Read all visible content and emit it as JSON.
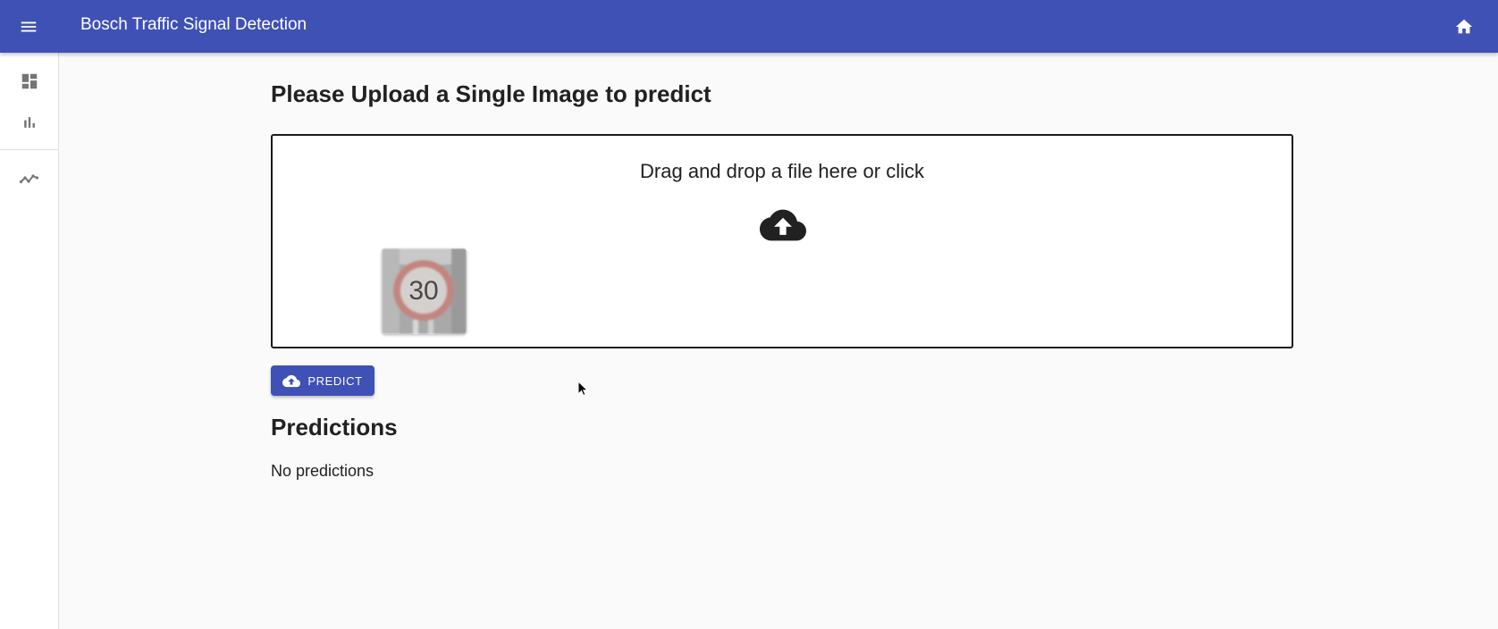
{
  "appbar": {
    "title": "Bosch Traffic Signal Detection",
    "menu_icon": "menu-icon",
    "home_icon": "home-icon",
    "color": "#3f51b5"
  },
  "drawer": {
    "items": [
      {
        "icon": "dashboard-icon"
      },
      {
        "icon": "bar-chart-icon"
      },
      {
        "icon": "timeline-icon"
      }
    ]
  },
  "upload": {
    "heading": "Please Upload a Single Image to predict",
    "dropzone_text": "Drag and drop a file here or click",
    "dropzone_icon": "cloud-upload-icon",
    "thumbnail_sign_text": "30"
  },
  "predict_button": {
    "label": "PREDICT",
    "icon": "cloud-upload-icon"
  },
  "predictions": {
    "heading": "Predictions",
    "empty_text": "No predictions"
  }
}
